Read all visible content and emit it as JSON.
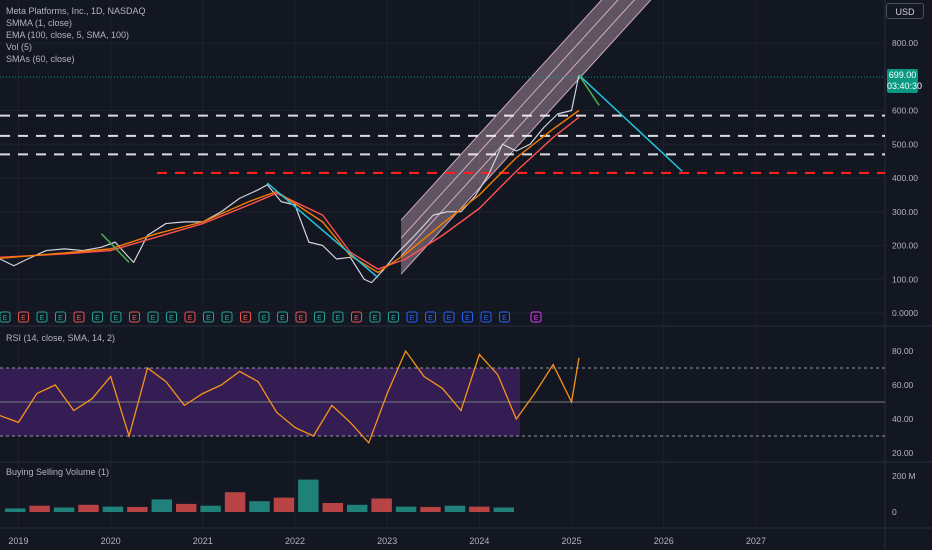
{
  "header": {
    "symbol": "Meta Platforms, Inc., 1D, NASDAQ",
    "indicators": [
      "SMMA (1, close)",
      "EMA (100, close, 5, SMA, 100)",
      "Vol (5)",
      "SMAs (60, close)"
    ],
    "currency": "USD"
  },
  "last_price": {
    "value": "699.00",
    "countdown": "03:40:30"
  },
  "panes": {
    "rsi_label": "RSI (14, close, SMA, 14, 2)",
    "volume_label": "Buying Selling Volume (1)"
  },
  "colors": {
    "background": "#131722",
    "price": "#d1d4dc",
    "ema": "#ff5252",
    "sma": "#f57c00",
    "channel": "#f3c6d9",
    "cyan": "#22c6e0",
    "green": "#4caf50",
    "support": "#ffffff",
    "key_level": "#ff1f1f",
    "rsi_line": "#f7931a",
    "rsi_band": "#3a1f5c",
    "up_tag": "#089981"
  },
  "chart_data": [
    {
      "type": "line",
      "title": "Meta Platforms, Inc., 1D, NASDAQ",
      "xlabel": "",
      "ylabel": "",
      "x_ticks": [
        "2019",
        "2020",
        "2021",
        "2022",
        "2023",
        "2024",
        "2025",
        "2026",
        "2027"
      ],
      "y_ticks": [
        "0.0000",
        "100.00",
        "200.00",
        "300.00",
        "400.00",
        "500.00",
        "600.00",
        "800.00"
      ],
      "ylim": [
        0,
        830
      ],
      "xlim": [
        2018.8,
        2028.4
      ],
      "grid": true,
      "series": [
        {
          "x": [
            2018.8,
            2018.95,
            2019.1,
            2019.3,
            2019.5,
            2019.7,
            2019.9,
            2020.05,
            2020.18,
            2020.25,
            2020.4,
            2020.6,
            2020.8,
            2021.0,
            2021.2,
            2021.4,
            2021.6,
            2021.7,
            2021.85,
            2022.0,
            2022.15,
            2022.3,
            2022.45,
            2022.6,
            2022.75,
            2022.83,
            2022.95,
            2023.1,
            2023.3,
            2023.5,
            2023.65,
            2023.8,
            2023.95,
            2024.1,
            2024.25,
            2024.4,
            2024.55,
            2024.7,
            2024.85,
            2025.0,
            2025.08
          ],
          "values": [
            160,
            140,
            160,
            185,
            190,
            185,
            195,
            210,
            170,
            150,
            230,
            265,
            270,
            270,
            300,
            340,
            365,
            380,
            330,
            320,
            210,
            200,
            160,
            165,
            100,
            90,
            125,
            175,
            230,
            290,
            300,
            300,
            345,
            410,
            500,
            480,
            500,
            550,
            590,
            600,
            705
          ]
        },
        {
          "name": "EMA (100, close, 5, SMA, 100)",
          "x": [
            2018.8,
            2019.5,
            2020.0,
            2020.5,
            2021.0,
            2021.5,
            2021.8,
            2022.3,
            2022.6,
            2022.9,
            2023.2,
            2023.6,
            2024.0,
            2024.4,
            2024.8,
            2025.08
          ],
          "values": [
            165,
            175,
            185,
            225,
            265,
            320,
            355,
            290,
            180,
            130,
            160,
            230,
            310,
            420,
            520,
            580
          ]
        },
        {
          "name": "SMAs (60, close)",
          "x": [
            2018.8,
            2019.5,
            2020.0,
            2020.5,
            2021.0,
            2021.5,
            2021.8,
            2022.3,
            2022.6,
            2022.9,
            2023.2,
            2023.6,
            2024.0,
            2024.4,
            2024.8,
            2025.08
          ],
          "values": [
            162,
            178,
            190,
            235,
            270,
            330,
            360,
            270,
            170,
            120,
            175,
            265,
            350,
            460,
            545,
            600
          ]
        }
      ],
      "annotations": {
        "horizontal_levels_dashed_white": [
          585,
          525,
          470
        ],
        "horizontal_level_dashed_red": 415,
        "channel": {
          "from": [
            2023.15,
            275
          ],
          "to": [
            2026.0,
            1130
          ],
          "width": 160
        },
        "cyan_trendline_1": {
          "from": [
            2021.7,
            385
          ],
          "to": [
            2022.9,
            105
          ]
        },
        "cyan_trendline_2": {
          "from": [
            2025.08,
            705
          ],
          "to": [
            2026.2,
            420
          ]
        },
        "green_markers": [
          [
            2019.9,
            235
          ],
          [
            2020.2,
            150
          ],
          [
            2025.08,
            705
          ],
          [
            2025.3,
            615
          ]
        ],
        "last_price_line": 699
      },
      "earnings_markers": [
        "E",
        "E",
        "E",
        "E",
        "E",
        "E",
        "E",
        "E",
        "E",
        "E",
        "E",
        "E",
        "E",
        "E",
        "E",
        "E",
        "E",
        "E",
        "E",
        "E",
        "E",
        "E",
        "E",
        "E",
        "E",
        "E",
        "E",
        "E",
        "E"
      ]
    },
    {
      "type": "line",
      "title": "RSI (14, close, SMA, 14, 2)",
      "y_ticks": [
        "20.00",
        "40.00",
        "60.00",
        "80.00"
      ],
      "ylim": [
        15,
        90
      ],
      "levels": [
        70,
        50,
        30
      ],
      "series": [
        {
          "x": [
            2018.8,
            2019.0,
            2019.2,
            2019.4,
            2019.6,
            2019.8,
            2020.0,
            2020.2,
            2020.4,
            2020.6,
            2020.8,
            2021.0,
            2021.2,
            2021.4,
            2021.6,
            2021.8,
            2022.0,
            2022.2,
            2022.4,
            2022.6,
            2022.8,
            2023.0,
            2023.2,
            2023.4,
            2023.6,
            2023.8,
            2024.0,
            2024.2,
            2024.4,
            2024.6,
            2024.8,
            2025.0,
            2025.08
          ],
          "values": [
            42,
            38,
            55,
            60,
            45,
            52,
            65,
            30,
            70,
            62,
            48,
            55,
            60,
            68,
            62,
            44,
            35,
            30,
            48,
            38,
            26,
            55,
            80,
            65,
            58,
            45,
            78,
            66,
            40,
            55,
            72,
            50,
            76
          ]
        }
      ]
    },
    {
      "type": "bar",
      "title": "Buying Selling Volume (1)",
      "y_ticks": [
        "0",
        "200 M"
      ],
      "ylim": [
        0,
        200
      ],
      "values": [
        20,
        35,
        25,
        40,
        30,
        28,
        70,
        45,
        35,
        110,
        60,
        80,
        180,
        50,
        40,
        75,
        30,
        28,
        35,
        30,
        25
      ]
    }
  ]
}
